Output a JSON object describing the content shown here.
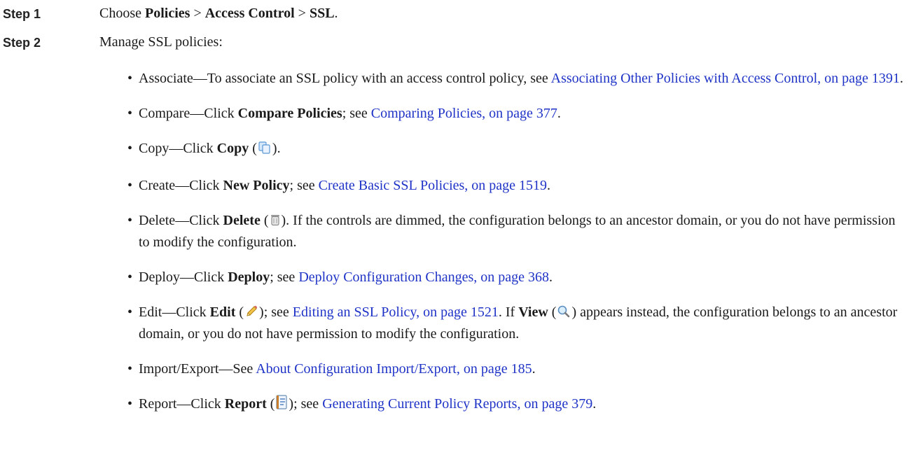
{
  "step1": {
    "label": "Step 1",
    "intro": "Choose ",
    "menu1": "Policies",
    "sep1": " > ",
    "menu2": "Access Control",
    "sep2": " > ",
    "menu3": "SSL",
    "end": "."
  },
  "step2": {
    "label": "Step 2",
    "text": "Manage SSL policies:"
  },
  "bullets": {
    "associate": {
      "lead": "Associate—To associate an SSL policy with an access control policy, see ",
      "link": "Associating Other Policies with Access Control, on page 1391",
      "end": "."
    },
    "compare": {
      "lead": "Compare—Click ",
      "bold": "Compare Policies",
      "mid": "; see ",
      "link": "Comparing Policies, on page 377",
      "end": "."
    },
    "copy": {
      "lead": "Copy—Click ",
      "bold": "Copy",
      "open": " (",
      "close": ").",
      "icon": "copy-icon"
    },
    "create": {
      "lead": "Create—Click ",
      "bold": "New Policy",
      "mid": "; see ",
      "link": "Create Basic SSL Policies, on page 1519",
      "end": "."
    },
    "delete": {
      "lead": "Delete—Click ",
      "bold": "Delete",
      "open": " (",
      "close": ")",
      "rest": ". If the controls are dimmed, the configuration belongs to an ancestor domain, or you do not have permission to modify the configuration.",
      "icon": "trash-icon"
    },
    "deploy": {
      "lead": "Deploy—Click ",
      "bold": "Deploy",
      "mid": "; see ",
      "link": "Deploy Configuration Changes, on page 368",
      "end": "."
    },
    "edit": {
      "lead": "Edit—Click ",
      "bold": "Edit",
      "open": " (",
      "close": "); see ",
      "link": "Editing an SSL Policy, on page 1521",
      "mid2": ". If ",
      "bold2": "View",
      "open2": " (",
      "close2": ")",
      "rest": " appears instead, the configuration belongs to an ancestor domain, or you do not have permission to modify the configuration.",
      "icon": "pencil-icon",
      "icon2": "magnifier-icon"
    },
    "import": {
      "lead": "Import/Export—See ",
      "link": "About Configuration Import/Export, on page 185",
      "end": "."
    },
    "report": {
      "lead": "Report—Click ",
      "bold": "Report",
      "open": " (",
      "close": "); see ",
      "link": "Generating Current Policy Reports, on page 379",
      "end": ".",
      "icon": "report-icon"
    }
  },
  "colors": {
    "link": "#1f33c7",
    "text": "#1a1a1a"
  }
}
